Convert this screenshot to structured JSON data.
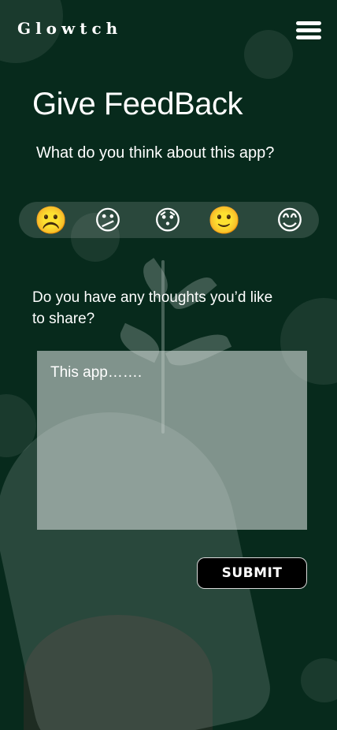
{
  "header": {
    "brand": "Glowtch",
    "menu_icon": "hamburger-menu-icon"
  },
  "page": {
    "title": "Give FeedBack",
    "question": "What do you think about this app?"
  },
  "rating": {
    "options": [
      {
        "icon": "sad-face-icon",
        "glyph": "☹️"
      },
      {
        "icon": "confused-face-icon",
        "glyph": "😕"
      },
      {
        "icon": "surprised-face-icon",
        "glyph": "😯"
      },
      {
        "icon": "slight-smile-face-icon",
        "glyph": "🙂"
      },
      {
        "icon": "happy-face-icon",
        "glyph": "😊"
      }
    ]
  },
  "feedback": {
    "prompt": "Do you have any thoughts you’d like to share?",
    "placeholder": "This app……."
  },
  "actions": {
    "submit_label": "SUBMIT"
  },
  "colors": {
    "background": "#072a1c",
    "text": "#ffffff",
    "textarea_bg": "#9aa7a1",
    "button_bg": "#000000"
  }
}
